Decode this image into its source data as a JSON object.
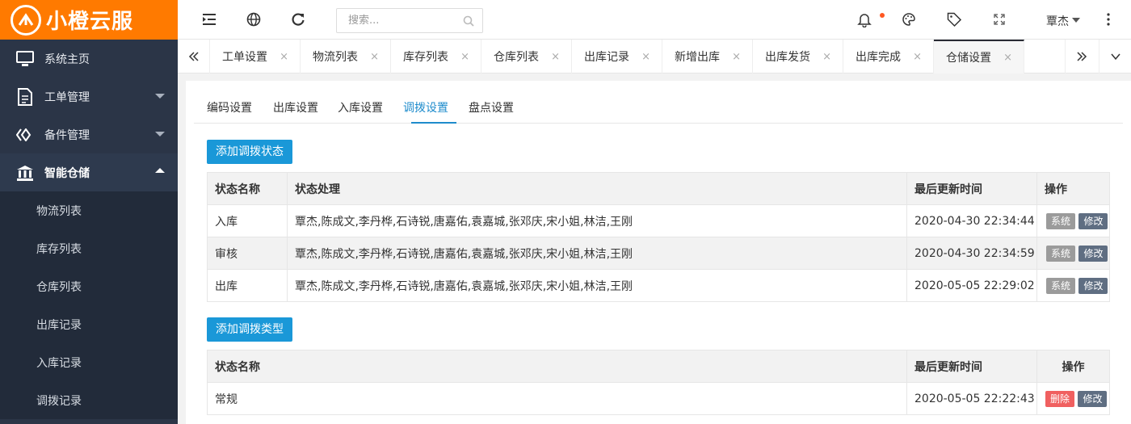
{
  "app": {
    "logo_text": "小橙云服",
    "brand_color": "#ff7a00",
    "accent_color": "#1a98d8"
  },
  "sidebar": {
    "items": [
      {
        "label": "系统主页",
        "icon": "monitor-icon"
      },
      {
        "label": "工单管理",
        "icon": "document-icon"
      },
      {
        "label": "备件管理",
        "icon": "diamond-icon"
      },
      {
        "label": "智能仓储",
        "icon": "bank-icon"
      }
    ],
    "sub_items": [
      "物流列表",
      "库存列表",
      "仓库列表",
      "出库记录",
      "入库记录",
      "调拨记录"
    ]
  },
  "header": {
    "search_placeholder": "搜索...",
    "user_name": "覃杰"
  },
  "tabs": [
    "工单设置",
    "物流列表",
    "库存列表",
    "仓库列表",
    "出库记录",
    "新增出库",
    "出库发货",
    "出库完成",
    "仓储设置"
  ],
  "tab_close": "×",
  "subtabs": [
    "编码设置",
    "出库设置",
    "入库设置",
    "调拨设置",
    "盘点设置"
  ],
  "table1": {
    "add_button": "添加调拨状态",
    "headers": [
      "状态名称",
      "状态处理",
      "最后更新时间",
      "操作"
    ],
    "rows": [
      {
        "name": "入库",
        "handlers": "覃杰,陈成文,李丹桦,石诗锐,唐嘉佑,袁嘉城,张邓庆,宋小姐,林洁,王刚",
        "time": "2020-04-30 22:34:44",
        "tag": "系统",
        "edit": "修改"
      },
      {
        "name": "审核",
        "handlers": "覃杰,陈成文,李丹桦,石诗锐,唐嘉佑,袁嘉城,张邓庆,宋小姐,林洁,王刚",
        "time": "2020-04-30 22:34:59",
        "tag": "系统",
        "edit": "修改"
      },
      {
        "name": "出库",
        "handlers": "覃杰,陈成文,李丹桦,石诗锐,唐嘉佑,袁嘉城,张邓庆,宋小姐,林洁,王刚",
        "time": "2020-05-05 22:29:02",
        "tag": "系统",
        "edit": "修改"
      }
    ]
  },
  "table2": {
    "add_button": "添加调拨类型",
    "headers": [
      "状态名称",
      "最后更新时间",
      "操作"
    ],
    "rows": [
      {
        "name": "常规",
        "time": "2020-05-05 22:22:43",
        "del": "删除",
        "edit": "修改"
      }
    ]
  }
}
